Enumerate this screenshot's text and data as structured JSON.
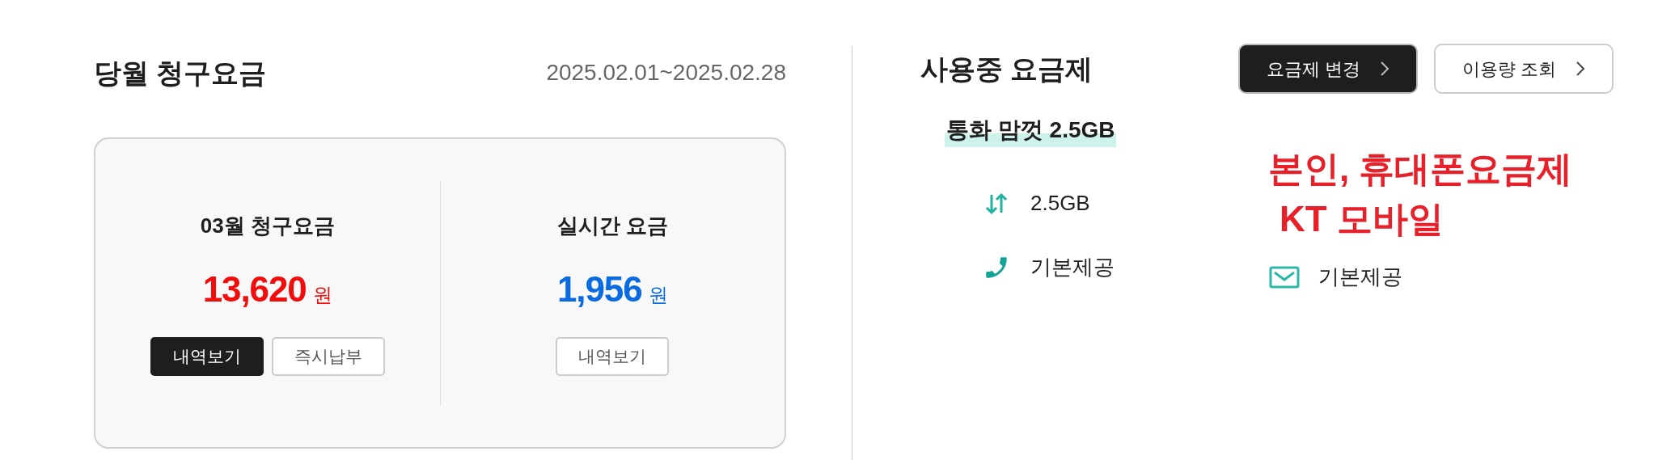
{
  "billing": {
    "title": "당월 청구요금",
    "period": "2025.02.01~2025.02.28",
    "panels": [
      {
        "label": "03월 청구요금",
        "amount": "13,620",
        "unit": "원",
        "color": "#f20d0d",
        "buttons": [
          {
            "label": "내역보기",
            "selected": true
          },
          {
            "label": "즉시납부",
            "selected": false
          }
        ]
      },
      {
        "label": "실시간 요금",
        "amount": "1,956",
        "unit": "원",
        "color": "#0a6be0",
        "buttons": [
          {
            "label": "내역보기",
            "selected": false
          }
        ]
      }
    ]
  },
  "plan": {
    "title": "사용중 요금제",
    "buttons": [
      {
        "label": "요금제 변경",
        "selected": true
      },
      {
        "label": "이용량 조회",
        "selected": false
      }
    ],
    "name": "통화 맘껏 2.5GB",
    "features": [
      {
        "kind": "data",
        "text": "2.5GB"
      },
      {
        "kind": "call",
        "text": "기본제공"
      },
      {
        "kind": "message",
        "text": "기본제공"
      }
    ],
    "annotation": [
      "본인, 휴대폰요금제",
      "KT 모바일"
    ]
  }
}
